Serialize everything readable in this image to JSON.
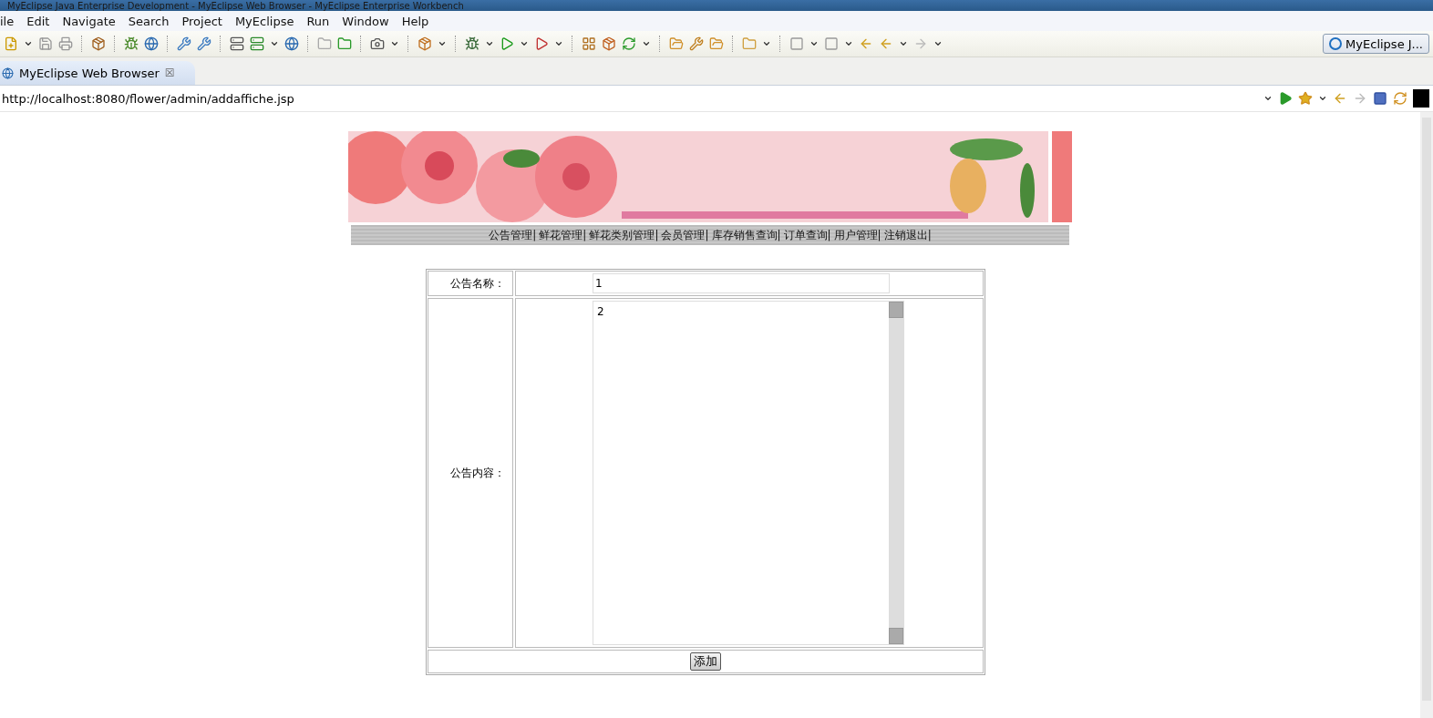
{
  "window": {
    "title": "MyEclipse Java Enterprise Development - MyEclipse Web Browser - MyEclipse Enterprise Workbench"
  },
  "menu": [
    "ile",
    "Edit",
    "Navigate",
    "Search",
    "Project",
    "MyEclipse",
    "Run",
    "Window",
    "Help"
  ],
  "perspective": {
    "label": "MyEclipse J..."
  },
  "editor_tab": {
    "label": "MyEclipse Web Browser",
    "close": "☒"
  },
  "address": {
    "value": "http://localhost:8080/flower/admin/addaffiche.jsp"
  },
  "page": {
    "banner": {
      "kind": "picture"
    },
    "nav": [
      "公告管理|",
      "鲜花管理|",
      "鲜花类别管理|",
      "会员管理|",
      "库存销售查询|",
      "订单查询|",
      "用户管理|",
      "注销退出|"
    ],
    "form": {
      "name_label": "公告名称：",
      "name_value": "1",
      "content_label": "公告内容：",
      "content_value": "2",
      "submit": "添加"
    }
  }
}
